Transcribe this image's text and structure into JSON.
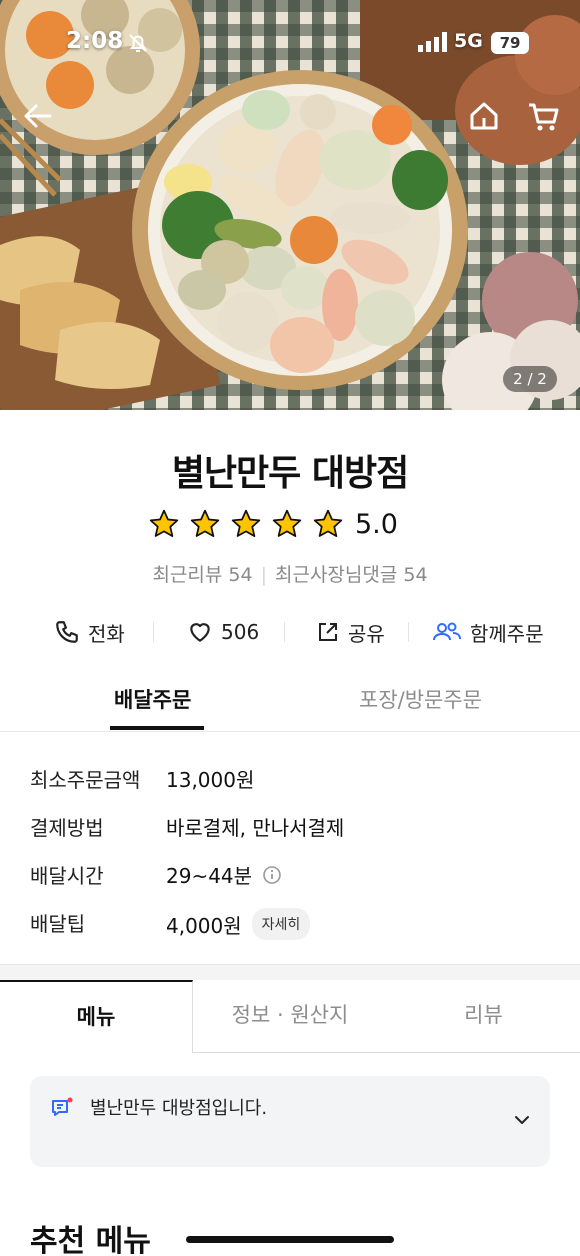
{
  "status": {
    "time": "2:08",
    "network": "5G",
    "battery": "79"
  },
  "hero": {
    "pager": "2 / 2"
  },
  "store": {
    "name": "별난만두 대방점",
    "rating_value": 5.0,
    "rating_text": "5.0",
    "stars": 5,
    "recent_reviews": "최근리뷰 54",
    "owner_replies": "최근사장님댓글 54"
  },
  "actions": {
    "call": "전화",
    "likes": "506",
    "share": "공유",
    "group_order": "함께주문"
  },
  "order_tabs": {
    "delivery": "배달주문",
    "pickup": "포장/방문주문"
  },
  "info": {
    "min_order_label": "최소주문금액",
    "min_order_value": "13,000원",
    "payment_label": "결제방법",
    "payment_value": "바로결제, 만나서결제",
    "delivery_time_label": "배달시간",
    "delivery_time_value": "29~44분",
    "delivery_tip_label": "배달팁",
    "delivery_tip_value": "4,000원",
    "detail_button": "자세히"
  },
  "menu_tabs": {
    "menu": "메뉴",
    "info": "정보 · 원산지",
    "review": "리뷰"
  },
  "notice": {
    "text": "별난만두 대방점입니다."
  },
  "sections": {
    "recommended": "추천 메뉴"
  },
  "colors": {
    "star": "#FFC400",
    "accent_blue": "#2F6BFF",
    "notice_red": "#FF3B5C"
  }
}
